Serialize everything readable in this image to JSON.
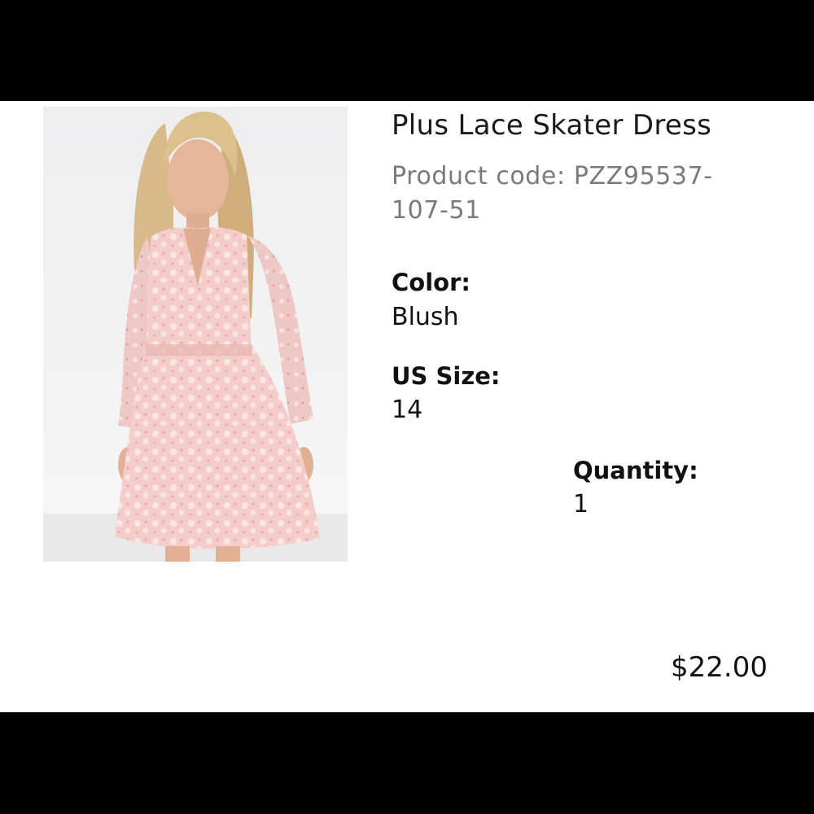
{
  "product": {
    "name": "Plus Lace Skater Dress",
    "code_line1": "Product code: PZZ95537-",
    "code_line2": "107-51",
    "color_label": "Color:",
    "color_value": "Blush",
    "size_label": "US Size:",
    "size_value": "14",
    "quantity_label": "Quantity:",
    "quantity_value": "1",
    "price": "$22.00",
    "image_icon": "product-photo-icon"
  },
  "colors": {
    "background": "#ffffff",
    "letterbox": "#000000",
    "dress": "#f2c6c3",
    "code_text": "#7a7a7a"
  }
}
